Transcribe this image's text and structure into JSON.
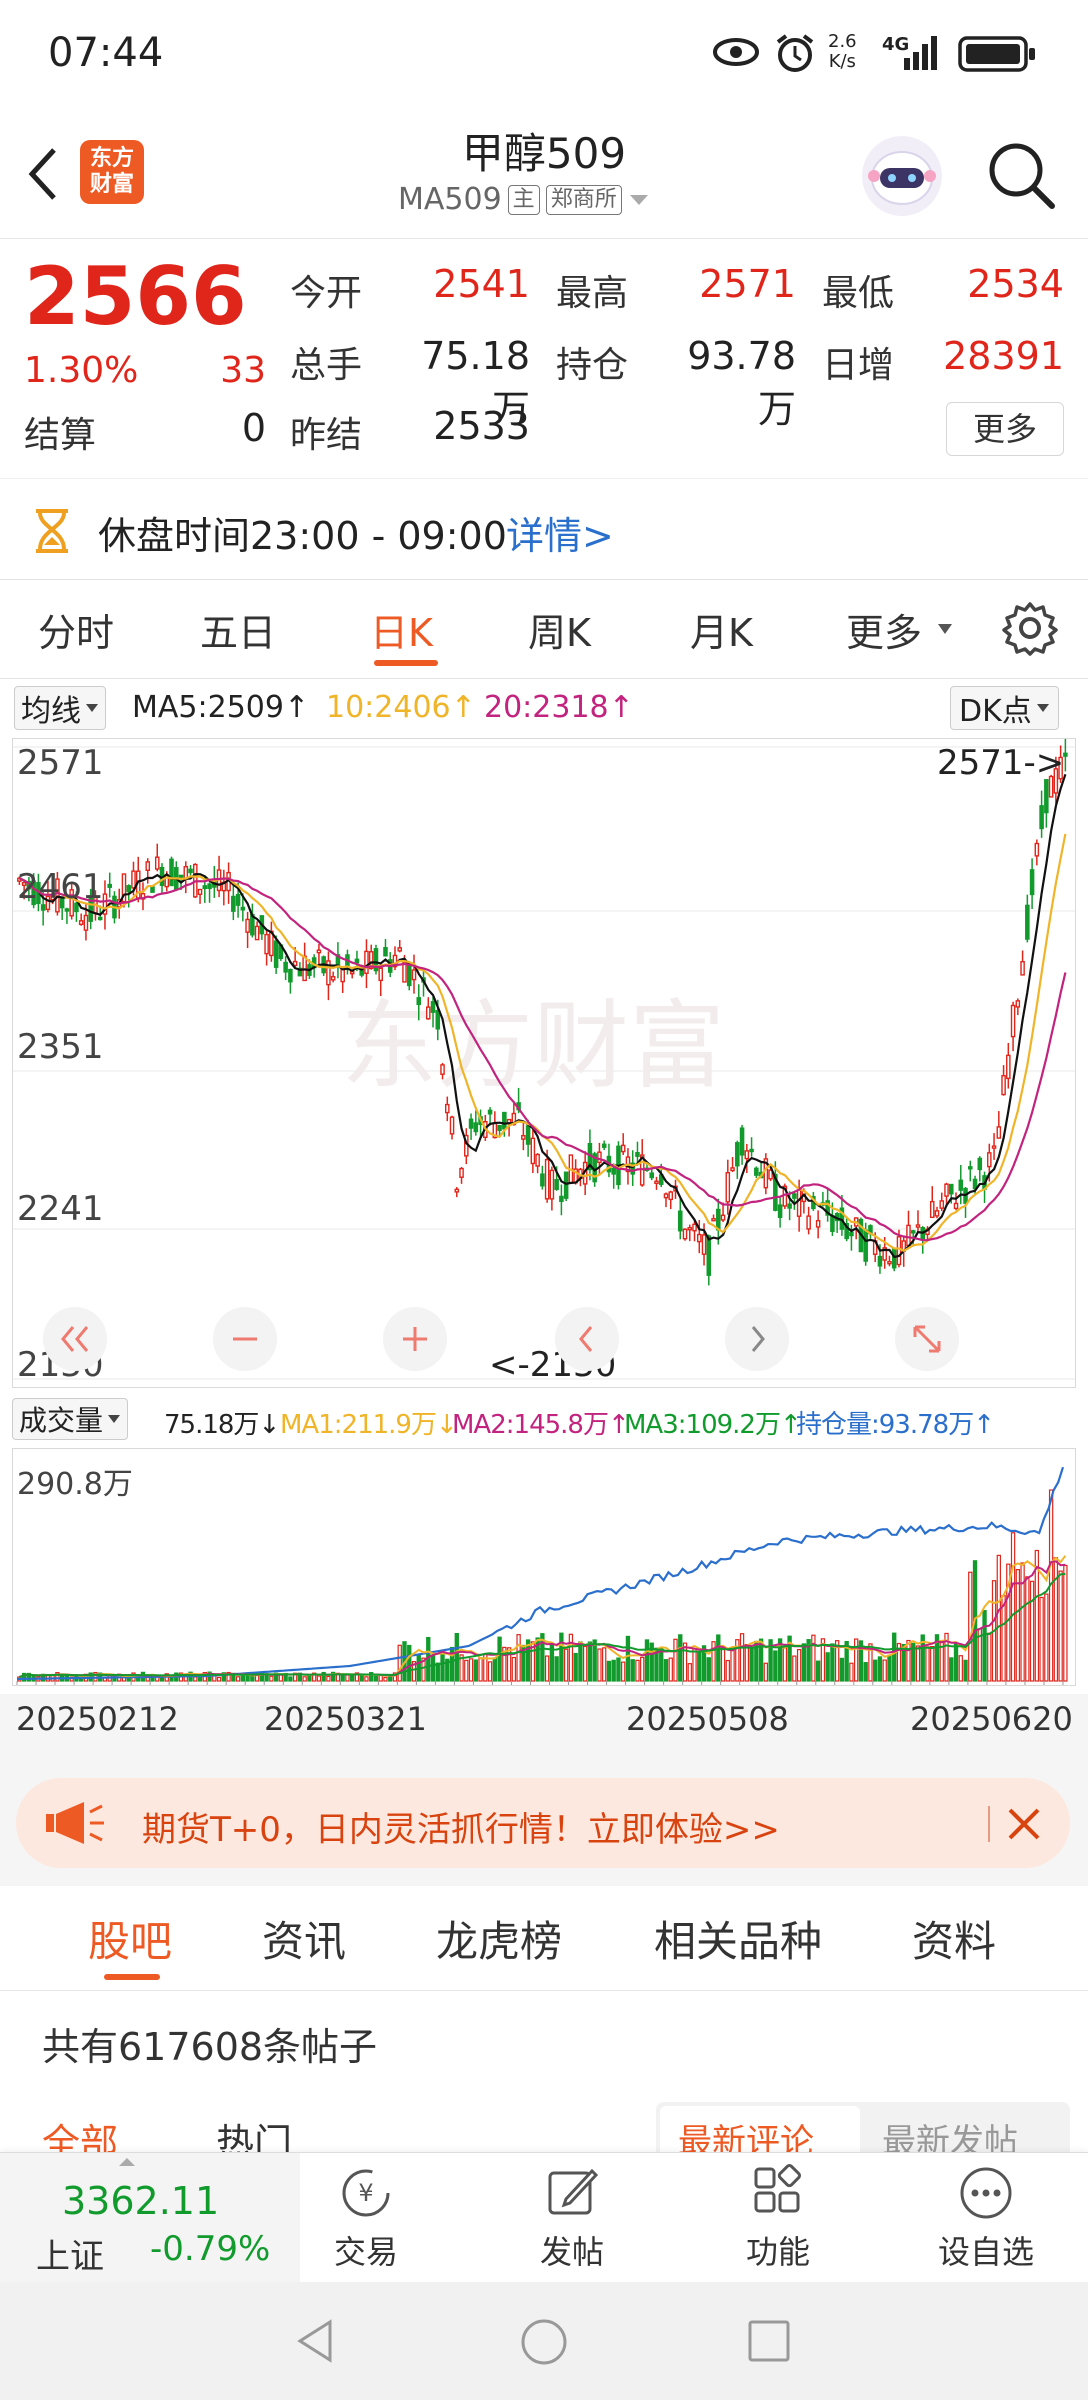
{
  "status_bar": {
    "time": "07:44",
    "net_speed_top": "2.6",
    "net_speed_bottom": "K/s",
    "signal": "4G"
  },
  "header": {
    "logo_line1": "东方",
    "logo_line2": "财富",
    "title": "甲醇509",
    "code": "MA509",
    "tag_main": "主",
    "tag_exchange": "郑商所"
  },
  "quote": {
    "price": "2566",
    "change_pct": "1.30%",
    "change": "33",
    "settle_label": "结算",
    "settle_value": "0",
    "stats": [
      {
        "label": "今开",
        "value": "2541",
        "color": "red"
      },
      {
        "label": "最高",
        "value": "2571",
        "color": "red"
      },
      {
        "label": "最低",
        "value": "2534",
        "color": "red"
      },
      {
        "label": "总手",
        "value": "75.18万",
        "color": "black"
      },
      {
        "label": "持仓",
        "value": "93.78万",
        "color": "black"
      },
      {
        "label": "日增",
        "value": "28391",
        "color": "red"
      },
      {
        "label": "昨结",
        "value": "2533",
        "color": "black"
      }
    ],
    "more_label": "更多"
  },
  "notice": {
    "text": "休盘时间23:00 - 09:00",
    "link": "详情>"
  },
  "period_tabs": [
    "分时",
    "五日",
    "日K",
    "周K",
    "月K",
    "更多"
  ],
  "period_active": 2,
  "indicator_bar": {
    "selector": "均线",
    "ma5": "MA5:2509",
    "ma10": "10:2406",
    "ma20": "20:2318",
    "dk_label": "DK点"
  },
  "kline": {
    "y_ticks": [
      "2571",
      "2461",
      "2351",
      "2241",
      "2130"
    ],
    "high_marker": "2571->",
    "low_marker": "<-2130",
    "watermark": "东方财富"
  },
  "volume_bar": {
    "selector": "成交量",
    "vol": "75.18万",
    "ma1": "MA1:211.9万",
    "ma2": "MA2:145.8万",
    "ma3": "MA3:109.2万",
    "oi": "持仓量:93.78万",
    "max_label": "290.8万"
  },
  "x_dates": [
    "20250212",
    "20250321",
    "20250508",
    "20250620"
  ],
  "banner": {
    "text": "期货T+0，日内灵活抓行情！立即体验>>"
  },
  "content_tabs": [
    "股吧",
    "资讯",
    "龙虎榜",
    "相关品种",
    "资料"
  ],
  "content_active": 0,
  "posts": {
    "count_text": "共有617608条帖子",
    "filter_all": "全部",
    "filter_hot": "热门",
    "sort_latest_comment": "最新评论",
    "sort_latest_post": "最新发帖"
  },
  "bottom_nav": {
    "index_value": "3362.11",
    "index_name": "上证",
    "index_change": "-0.79%",
    "items": [
      "交易",
      "发帖",
      "功能",
      "设自选"
    ]
  },
  "colors": {
    "up": "#e0251b",
    "down": "#129b2d",
    "accent": "#ee5a24",
    "ma5": "#111111",
    "ma10": "#f0b429",
    "ma20": "#c2237e",
    "oi_line": "#2b6fcd"
  }
}
